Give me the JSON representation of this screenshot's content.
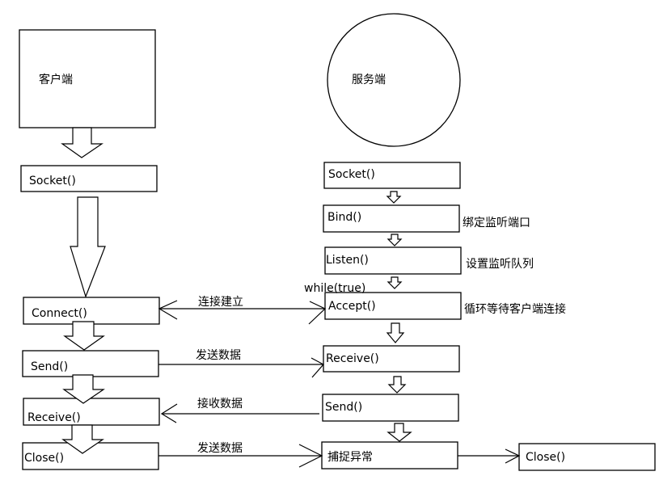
{
  "client": {
    "title": "客户端",
    "steps": [
      "Socket()",
      "Connect()",
      "Send()",
      "Receive()",
      "Close()"
    ]
  },
  "server": {
    "title": "服务端",
    "steps": [
      "Socket()",
      "Bind()",
      "Listen()",
      "Accept()",
      "Receive()",
      "Send()",
      "捕捉异常"
    ],
    "close": "Close()",
    "notes": {
      "bind": "绑定监听端口",
      "listen": "设置监听队列",
      "accept": "循环等待客户端连接",
      "loop": "while(true)"
    }
  },
  "messages": {
    "connect": "连接建立",
    "send": "发送数据",
    "receive": "接收数据",
    "close": "发送数据"
  }
}
